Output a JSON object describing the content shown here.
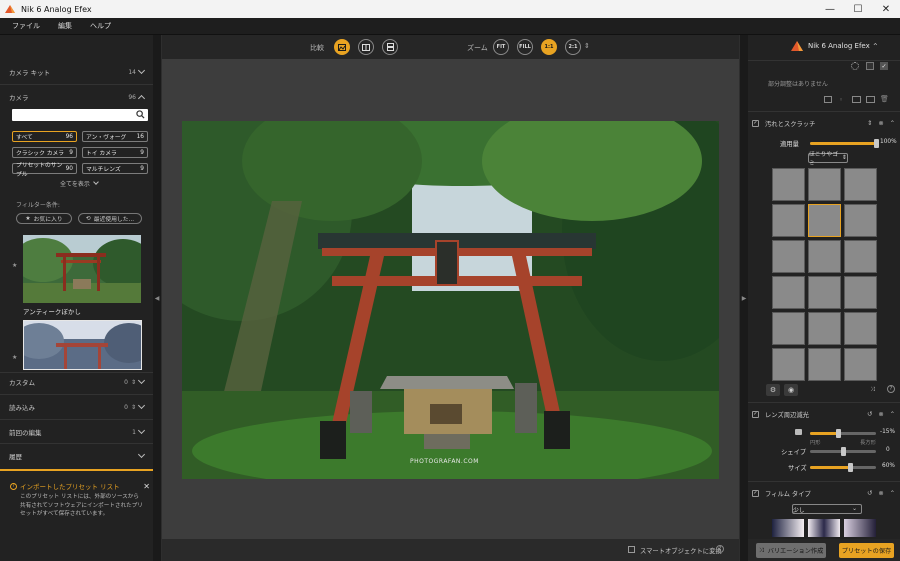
{
  "window": {
    "title": "Nik 6 Analog Efex"
  },
  "menu": [
    "ファイル",
    "編集",
    "ヘルプ"
  ],
  "left": {
    "camera_kit": {
      "label": "カメラ キット",
      "count": "14"
    },
    "camera": {
      "label": "カメラ",
      "count": "96"
    },
    "search_placeholder": "",
    "tags": [
      {
        "label": "すべて",
        "count": "96",
        "selected": true
      },
      {
        "label": "アン・ヴォーグ",
        "count": "16"
      },
      {
        "label": "クラシック カメラ",
        "count": "9"
      },
      {
        "label": "トイ カメラ",
        "count": "9"
      },
      {
        "label": "プリセットのサンプル",
        "count": "90"
      },
      {
        "label": "マルチレンズ",
        "count": "9"
      }
    ],
    "show_all": "全てを表示",
    "filter_label": "フィルター条件:",
    "favorites": "お気に入り",
    "recent": "最近使用した...",
    "preset1_name": "アンティークぼかし",
    "custom": {
      "label": "カスタム",
      "count": "0"
    },
    "imports": {
      "label": "読み込み",
      "count": "0"
    },
    "last_edit": {
      "label": "前回の編集",
      "count": "1"
    },
    "history": {
      "label": "履歴"
    },
    "import_notice": {
      "title": "インポートしたプリセット リスト",
      "body": "このプリセット リストには、外部のソースから共有されてソフトウェアにインポートされたプリセットがすべて保存されています。"
    }
  },
  "toolbar": {
    "compare": "比較",
    "zoom": "ズーム",
    "zoom_fit": "FIT",
    "zoom_fill": "FILL",
    "zoom_1to1": "1:1",
    "zoom_2to1": "2:1"
  },
  "bottom": {
    "smart_object": "スマートオブジェクトに変換"
  },
  "photo": {
    "watermark": "PHOTOGRAFAN.COM"
  },
  "right": {
    "brand": "Nik 6 Analog Efex",
    "no_local": "部分調整はありません",
    "dirt": {
      "title": "汚れとスクラッチ",
      "amount_label": "適用量",
      "amount_value": "100%",
      "amount": 1.0,
      "type": "ほこりやゴミ"
    },
    "vignette": {
      "title": "レンズ周辺減光",
      "amount_value": "-15%",
      "amount": 0.42,
      "circle": "円形",
      "rect": "長方形",
      "shape_label": "シェイプ",
      "shape_value": "0",
      "shape": 0.5,
      "size_label": "サイズ",
      "size_value": "60%",
      "size": 0.6
    },
    "film": {
      "title": "フィルム タイプ",
      "value": "少し"
    },
    "variation_button": "バリエーション作成",
    "save_button": "プリセットの保存"
  },
  "colors": {
    "accent": "#e8a322"
  }
}
